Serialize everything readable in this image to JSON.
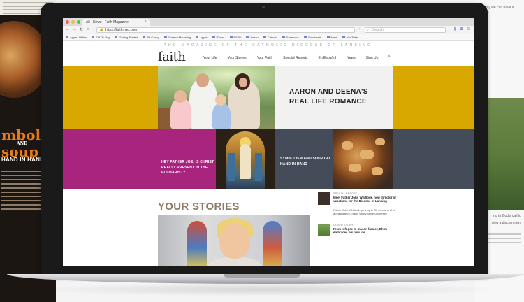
{
  "browser": {
    "tab_title": "All - News | Faith Magazine",
    "url": "https://faithmag.com",
    "search_placeholder": "Search",
    "bookmarks": [
      "Apple Utilities",
      "FAITH Mag",
      "Getting Started",
      "St. Casey",
      "Content Marketing",
      "Apple",
      "iTunes",
      "ESPN",
      "Yahoo",
      "Catholic",
      "Facebook",
      "Goodreads",
      "Maps",
      "YouTube"
    ]
  },
  "site": {
    "tagline": "THE MAGAZINE OF THE CATHOLIC DIOCESE OF LANSING",
    "logo": "faith",
    "nav": [
      "Your Life",
      "Your Stories",
      "Your Faith",
      "Special Reports",
      "En Español",
      "News",
      "Sign Up"
    ]
  },
  "hero": {
    "title": "AARON AND DEENA'S REAL LIFE ROMANCE"
  },
  "features": [
    {
      "title": "HEY FATHER JOE, IS CHRIST REALLY PRESENT IN THE EUCHARIST?"
    },
    {
      "title": "SYMBOLISM AND SOUP GO HAND IN HAND"
    }
  ],
  "stories": {
    "heading": "YOUR STORIES",
    "items": [
      {
        "label": "SPECIAL REPORT",
        "title": "Meet Father John Whitlock, new director of vocations for the Diocese of Lansing",
        "desc": "Father John Whitlock grew up in St. Johns, and is a graduate of Grand Valley State University."
      },
      {
        "label": "COVER STORY",
        "title": "From refugee to mason farmer, Bhim embraces his new life",
        "desc": ""
      }
    ]
  },
  "background_magazine": {
    "title_line1": "mbolism",
    "title_and": "AND",
    "title_line2": "soup",
    "subtitle": "HAND IN HAND"
  },
  "background_right": {
    "top_text": "ly way we can have a unse.",
    "caption1": "ing to God's call to",
    "caption2": "ging a discernment"
  },
  "colors": {
    "gold": "#d9a800",
    "magenta": "#a8257e",
    "slate": "#444c5a",
    "stories_heading": "#8c7a66"
  }
}
